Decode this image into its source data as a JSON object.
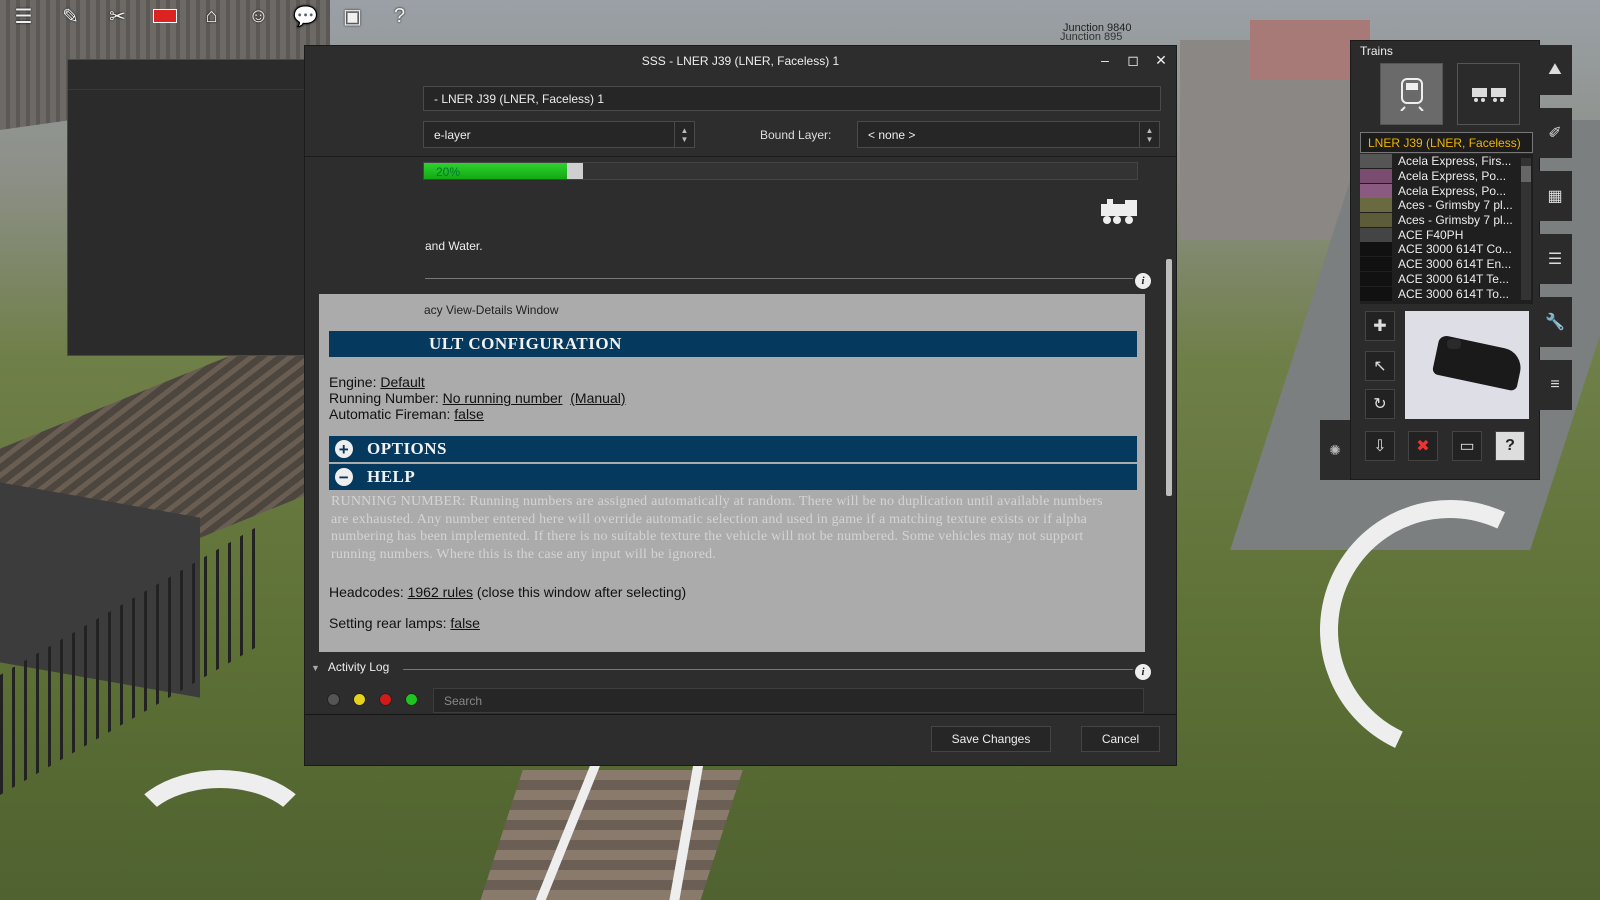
{
  "scene": {
    "junction_label_1": "Junction 9840",
    "junction_label_2": "Junction 895"
  },
  "toolbar": {
    "icons": [
      "menu-icon",
      "edit-icon",
      "tools-icon",
      "flag-icon",
      "camera-icon",
      "players-icon",
      "chat-icon",
      "window-icon",
      "help-icon"
    ]
  },
  "side_panel": {
    "close_label": "✕"
  },
  "dialog": {
    "title": "SSS - LNER J39 (LNER, Faceless) 1",
    "window_buttons": {
      "minimize": "–",
      "maximize": "◻",
      "close": "✕"
    },
    "name_value": "- LNER J39 (LNER, Faceless) 1",
    "layer_value": "e-layer",
    "bound_layer_label": "Bound Layer:",
    "bound_layer_value": "< none >",
    "progress_percent": 20,
    "progress_label": "20%",
    "water_text": "and Water.",
    "legacy_link": "acy View-Details Window",
    "default_header": "ULT CONFIGURATION",
    "engine_label": "Engine: ",
    "engine_value": "Default",
    "running_number_label": "Running Number: ",
    "running_number_value": "No running number",
    "running_number_manual": "(Manual)",
    "fireman_label": "Automatic Fireman: ",
    "fireman_value": "false",
    "options_header": "OPTIONS",
    "help_header": "HELP",
    "help_text": "RUNNING NUMBER: Running numbers are assigned automatically at random. There will be no duplication until available numbers are exhausted. Any number entered here will override automatic selection and used in game if a matching texture exists or if alpha numbering has been implemented.  If there is no suitable texture the vehicle will not be numbered.  Some vehicles may not support running numbers.  Where this is the case any input will be ignored.",
    "headcodes_label": "Headcodes: ",
    "headcodes_value": "1962 rules",
    "headcodes_suffix": " (close this window after selecting)",
    "rear_lamps_label": "Setting rear lamps: ",
    "rear_lamps_value": "false",
    "activity_log_label": "Activity Log",
    "search_placeholder": "Search",
    "save_label": "Save Changes",
    "cancel_label": "Cancel",
    "status_colors": [
      "#555555",
      "#e6d21a",
      "#d11a1a",
      "#1fc51f"
    ]
  },
  "trains": {
    "title": "Trains",
    "selected_name": "LNER J39 (LNER, Faceless)",
    "items": [
      "Acela Express, Firs...",
      "Acela Express, Po...",
      "Acela Express, Po...",
      "Aces - Grimsby 7 pl...",
      "Aces - Grimsby 7 pl...",
      "ACE F40PH",
      "ACE 3000 614T Co...",
      "ACE 3000 614T En...",
      "ACE 3000 614T Te...",
      "ACE 3000 614T To..."
    ],
    "help_glyph": "?"
  }
}
